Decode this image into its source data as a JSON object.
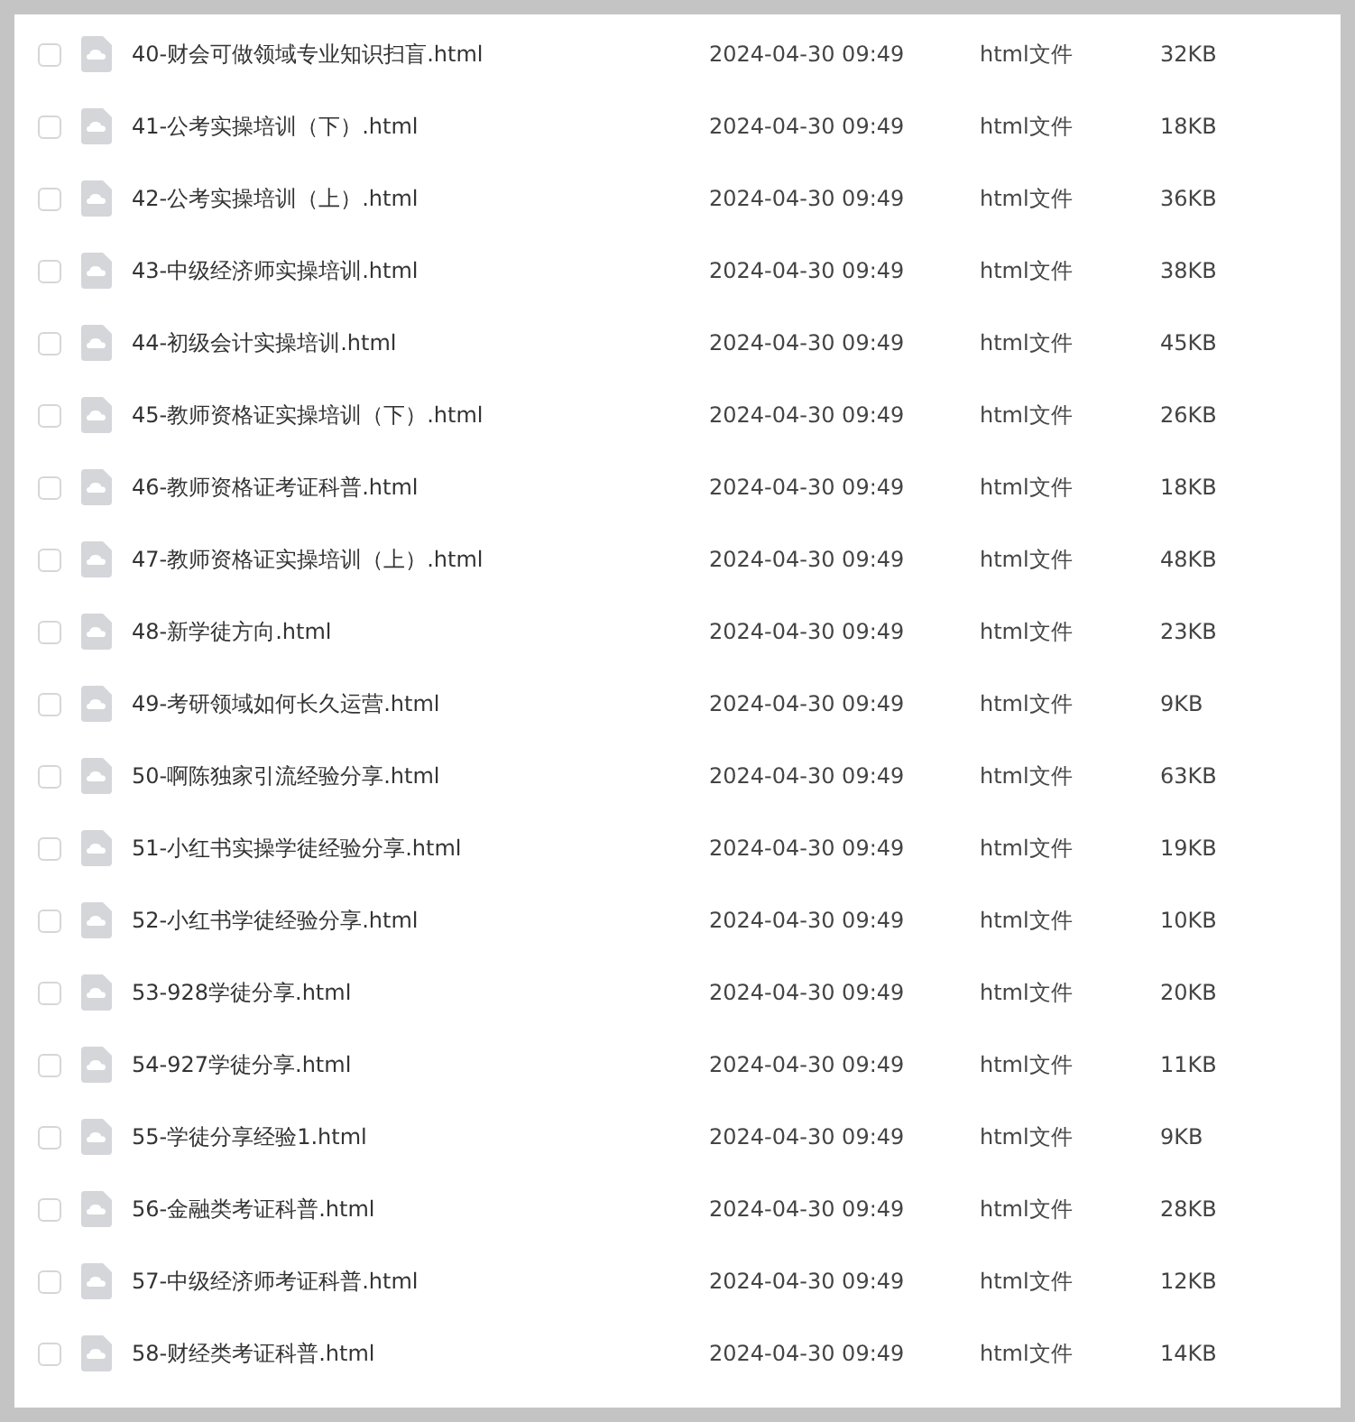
{
  "files": [
    {
      "name": "40-财会可做领域专业知识扫盲.html",
      "modified": "2024-04-30 09:49",
      "type": "html文件",
      "size": "32KB",
      "checked": false
    },
    {
      "name": "41-公考实操培训（下）.html",
      "modified": "2024-04-30 09:49",
      "type": "html文件",
      "size": "18KB",
      "checked": false
    },
    {
      "name": "42-公考实操培训（上）.html",
      "modified": "2024-04-30 09:49",
      "type": "html文件",
      "size": "36KB",
      "checked": false
    },
    {
      "name": "43-中级经济师实操培训.html",
      "modified": "2024-04-30 09:49",
      "type": "html文件",
      "size": "38KB",
      "checked": false
    },
    {
      "name": "44-初级会计实操培训.html",
      "modified": "2024-04-30 09:49",
      "type": "html文件",
      "size": "45KB",
      "checked": false
    },
    {
      "name": "45-教师资格证实操培训（下）.html",
      "modified": "2024-04-30 09:49",
      "type": "html文件",
      "size": "26KB",
      "checked": false
    },
    {
      "name": "46-教师资格证考证科普.html",
      "modified": "2024-04-30 09:49",
      "type": "html文件",
      "size": "18KB",
      "checked": false
    },
    {
      "name": "47-教师资格证实操培训（上）.html",
      "modified": "2024-04-30 09:49",
      "type": "html文件",
      "size": "48KB",
      "checked": false
    },
    {
      "name": "48-新学徒方向.html",
      "modified": "2024-04-30 09:49",
      "type": "html文件",
      "size": "23KB",
      "checked": false
    },
    {
      "name": "49-考研领域如何长久运营.html",
      "modified": "2024-04-30 09:49",
      "type": "html文件",
      "size": "9KB",
      "checked": false
    },
    {
      "name": "50-啊陈独家引流经验分享.html",
      "modified": "2024-04-30 09:49",
      "type": "html文件",
      "size": "63KB",
      "checked": false
    },
    {
      "name": "51-小红书实操学徒经验分享.html",
      "modified": "2024-04-30 09:49",
      "type": "html文件",
      "size": "19KB",
      "checked": false
    },
    {
      "name": "52-小红书学徒经验分享.html",
      "modified": "2024-04-30 09:49",
      "type": "html文件",
      "size": "10KB",
      "checked": false
    },
    {
      "name": "53-928学徒分享.html",
      "modified": "2024-04-30 09:49",
      "type": "html文件",
      "size": "20KB",
      "checked": false
    },
    {
      "name": "54-927学徒分享.html",
      "modified": "2024-04-30 09:49",
      "type": "html文件",
      "size": "11KB",
      "checked": false
    },
    {
      "name": "55-学徒分享经验1.html",
      "modified": "2024-04-30 09:49",
      "type": "html文件",
      "size": "9KB",
      "checked": false
    },
    {
      "name": "56-金融类考证科普.html",
      "modified": "2024-04-30 09:49",
      "type": "html文件",
      "size": "28KB",
      "checked": false
    },
    {
      "name": "57-中级经济师考证科普.html",
      "modified": "2024-04-30 09:49",
      "type": "html文件",
      "size": "12KB",
      "checked": false
    },
    {
      "name": "58-财经类考证科普.html",
      "modified": "2024-04-30 09:49",
      "type": "html文件",
      "size": "14KB",
      "checked": false
    }
  ]
}
